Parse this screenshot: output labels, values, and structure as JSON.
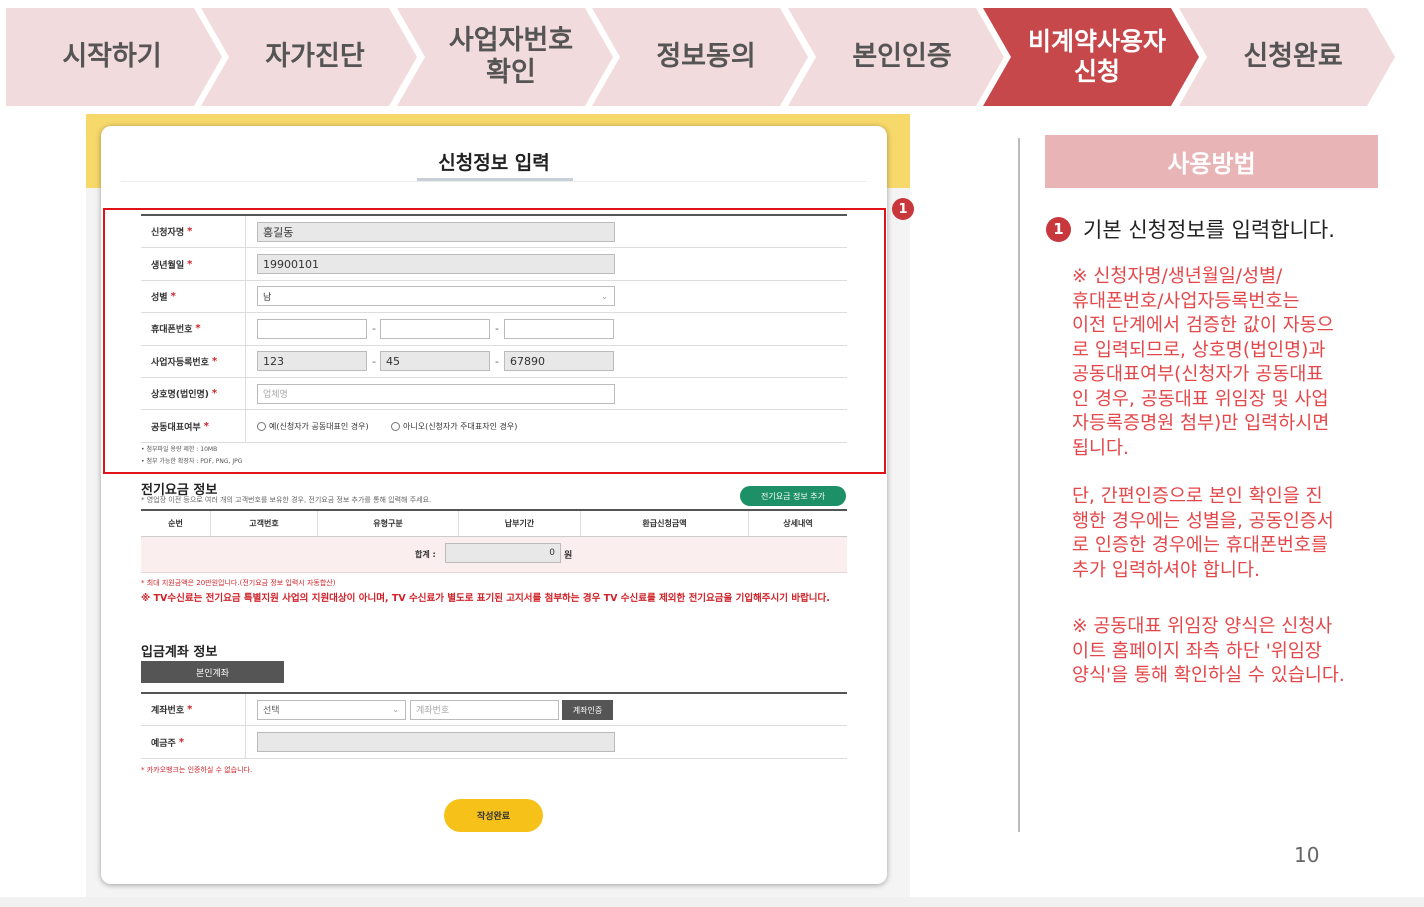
{
  "steps": [
    {
      "label": "시작하기",
      "active": false
    },
    {
      "label": "자가진단",
      "active": false
    },
    {
      "label": "사업자번호\n확인",
      "active": false
    },
    {
      "label": "정보동의",
      "active": false
    },
    {
      "label": "본인인증",
      "active": false
    },
    {
      "label": "비계약사용자\n신청",
      "active": true
    },
    {
      "label": "신청완료",
      "active": false
    }
  ],
  "form": {
    "title": "신청정보 입력",
    "required_mark": "*",
    "rows": {
      "name": {
        "label": "신청자명",
        "value": "홍길동"
      },
      "birth": {
        "label": "생년월일",
        "value": "19900101"
      },
      "gender": {
        "label": "성별",
        "value": "남"
      },
      "phone": {
        "label": "휴대폰번호",
        "parts": [
          "",
          "",
          ""
        ]
      },
      "bizno": {
        "label": "사업자등록번호",
        "parts": [
          "123",
          "45",
          "67890"
        ]
      },
      "company": {
        "label": "상호명(법인명)",
        "placeholder": "업체명"
      },
      "corep": {
        "label": "공동대표여부",
        "opt_yes": "예(신청자가 공동대표인 경우)",
        "opt_no": "아니오(신청자가 주대표자인 경우)"
      }
    },
    "dash": "-",
    "file_note1": "• 첨부파일 용량 제한 : 10MB",
    "file_note2": "• 첨부 가능한 확장자 : PDF, PNG, JPG"
  },
  "electric": {
    "title": "전기요금 정보",
    "subtitle": "* 영업장 이전 등으로 여러 개의 고객번호를 보유한 경우, 전기요금 정보 추가를 통해 입력해 주세요.",
    "add_button": "전기요금 정보 추가",
    "columns": [
      "순번",
      "고객번호",
      "유형구분",
      "납부기간",
      "환급신청금액",
      "상세내역"
    ],
    "sum_label": "합계 :",
    "sum_value": "0",
    "sum_unit": "원",
    "note_small": "* 최대 지원금액은 20만원입니다.(전기요금 정보 입력시 자동합산)",
    "note_big": "※ TV수신료는 전기요금 특별지원 사업의 지원대상이 아니며, TV 수신료가 별도로 표기된 고지서를 첨부하는 경우 TV 수신료를 제외한 전기요금을 기입해주시기 바랍니다."
  },
  "account": {
    "title": "입금계좌 정보",
    "tab": "본인계좌",
    "account_label": "계좌번호",
    "select_value": "선택",
    "account_placeholder": "계좌번호",
    "verify_button": "계좌인증",
    "holder_label": "예금주",
    "kakao_note": "* 카카오뱅크는 인증하실 수 없습니다."
  },
  "submit_button": "작성완료",
  "marker": "1",
  "panel": {
    "howto": "사용방법",
    "step_text": "기본 신청정보를 입력합니다.",
    "note1": "※ 신청자명/생년월일/성별/\n휴대폰번호/사업자등록번호는\n이전 단계에서 검증한 값이 자동으\n로 입력되므로, 상호명(법인명)과\n공동대표여부(신청자가 공동대표\n인 경우, 공동대표 위임장 및 사업\n자등록증명원 첨부)만 입력하시면\n됩니다.",
    "note2": "단, 간편인증으로 본인 확인을 진\n행한 경우에는 성별을, 공동인증서\n로 인증한 경우에는 휴대폰번호를\n추가 입력하셔야 합니다.",
    "note3": "※ 공동대표 위임장 양식은 신청사\n이트 홈페이지 좌측 하단 '위임장\n양식'을 통해 확인하실 수 있습니다."
  },
  "page_number": "10",
  "colors": {
    "accent": "#c6484b",
    "step_bg": "#f2dbdc",
    "frame": "#e0131b",
    "note": "#e4474a",
    "button_yellow": "#f6c21a",
    "button_green": "#1d9068"
  }
}
